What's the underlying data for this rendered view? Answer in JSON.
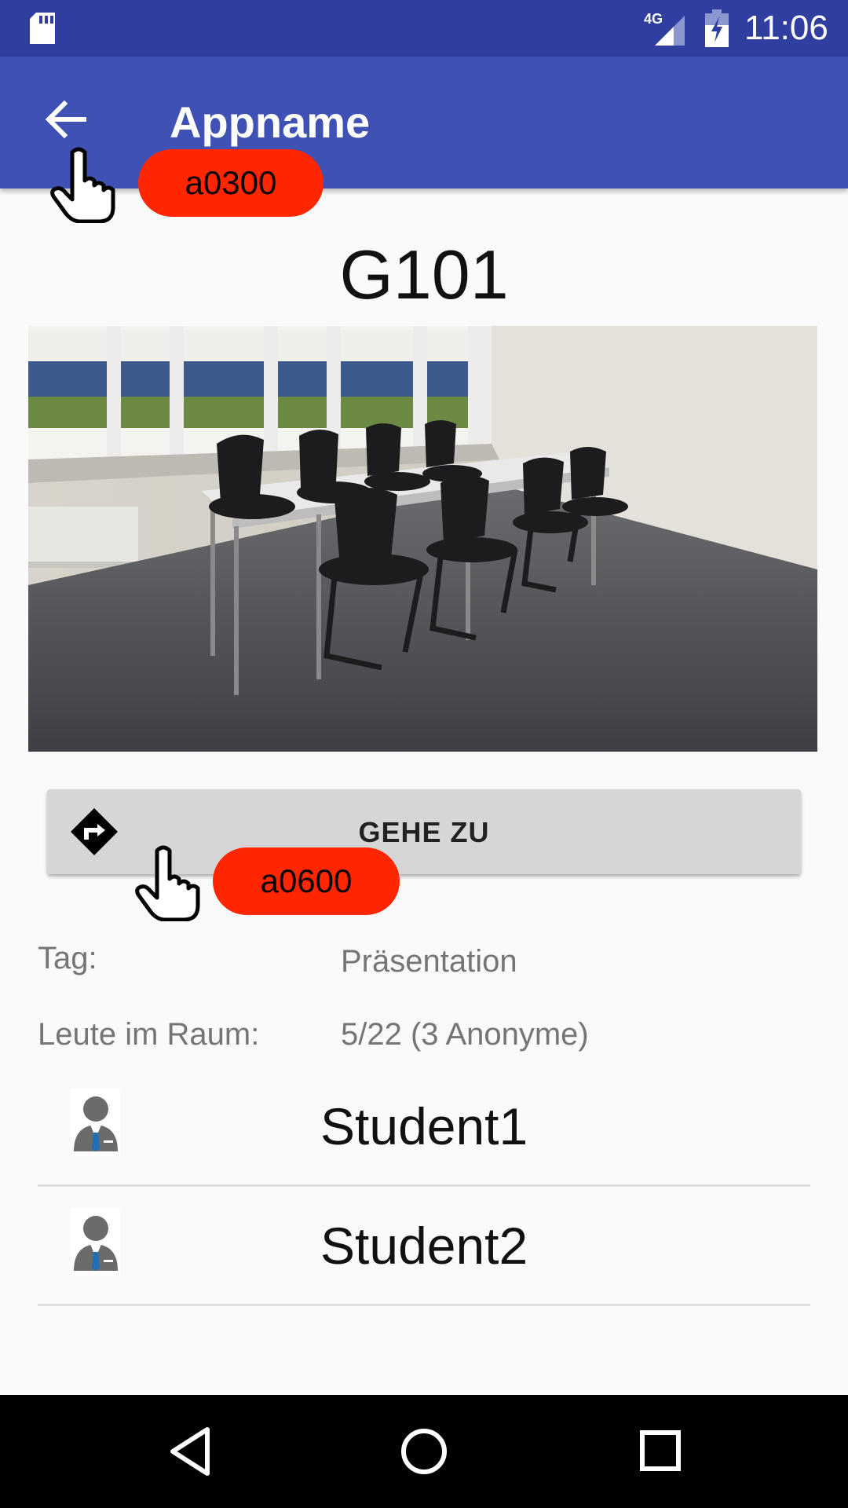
{
  "status_bar": {
    "network": "4G",
    "time": "11:06"
  },
  "app_bar": {
    "back_icon": "arrow-back-icon",
    "title": "Appname"
  },
  "room": {
    "title": "G101",
    "photo_alt": "G101"
  },
  "goto_button": {
    "icon": "directions-icon",
    "label": "GEHE ZU"
  },
  "info": {
    "tag_label": "Tag:",
    "tag_value": "Präsentation",
    "people_label": "Leute im Raum:",
    "people_value": "5/22 (3 Anonyme)"
  },
  "people": [
    {
      "name": "Student1",
      "icon": "person-icon"
    },
    {
      "name": "Student2",
      "icon": "person-icon"
    }
  ],
  "annotations": [
    {
      "label": "a0300",
      "icon": "tap-hand-icon"
    },
    {
      "label": "a0600",
      "icon": "tap-hand-icon"
    }
  ],
  "colors": {
    "status_bar": "#303f9f",
    "app_bar": "#3f51b5",
    "tap_badge": "#ff2600",
    "button_bg": "#d6d6d6"
  }
}
